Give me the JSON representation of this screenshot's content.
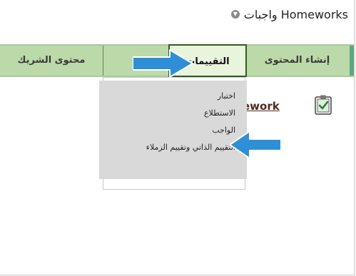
{
  "header": {
    "title": "واجبات Homeworks",
    "title_icon": "chevron-down-icon"
  },
  "tabs": [
    {
      "label": "إنشاء المحتوى",
      "active": false
    },
    {
      "label": "التقييمات",
      "active": true
    },
    {
      "label": "",
      "active": false
    },
    {
      "label": "محتوى الشريك",
      "active": false
    }
  ],
  "dropdown": {
    "items": [
      {
        "label": "اختبار"
      },
      {
        "label": "الاستطلاع"
      },
      {
        "label": "الواجب"
      },
      {
        "label": "التقييم الذاتي وتقييم الزملاء"
      }
    ]
  },
  "content": {
    "homework_link": "ework",
    "homework_icon": "clipboard-check-icon"
  },
  "annotations": {
    "arrow_icon": "arrow-right-icon",
    "arrow_color": "#2f8fd6"
  },
  "colors": {
    "tab_bar": "#bcd9a9",
    "active_tab": "#e9f4dc",
    "active_tab_border": "#2f5d1f",
    "dropdown_bg": "#d9d9d9",
    "accent_strip": "#5ea680"
  }
}
